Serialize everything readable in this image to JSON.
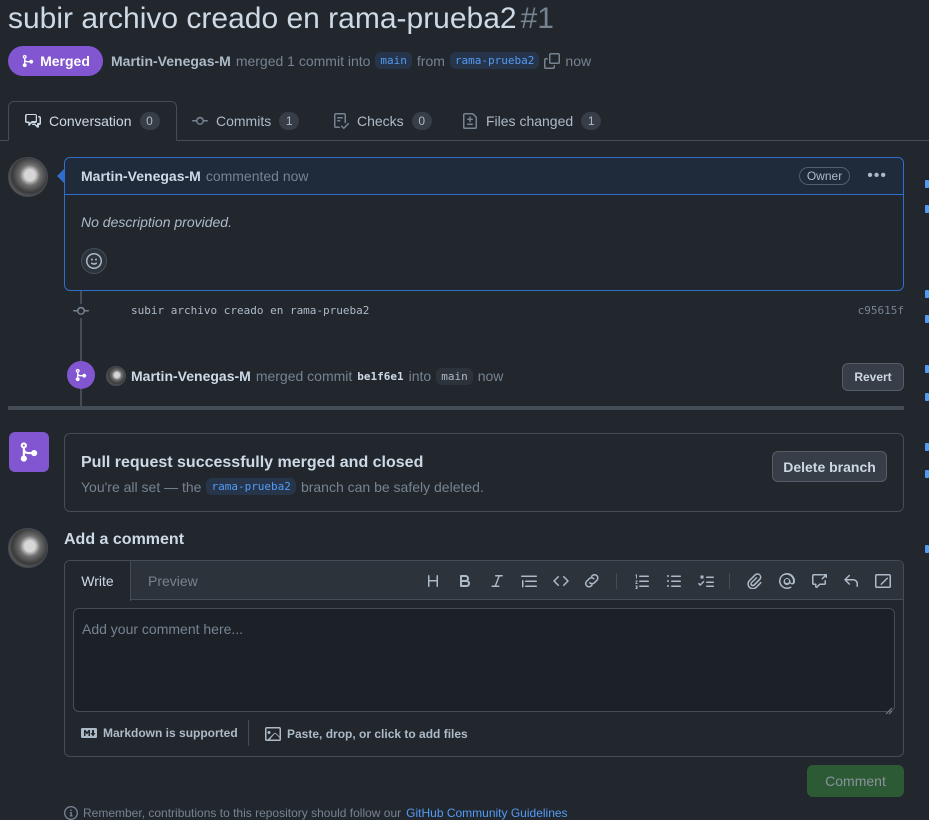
{
  "pr": {
    "title": "subir archivo creado en rama-prueba2",
    "number": "#1",
    "state_label": "Merged",
    "author": "Martin-Venegas-M",
    "merge_text": "merged 1 commit into",
    "base_branch": "main",
    "from_text": "from",
    "head_branch": "rama-prueba2",
    "time": "now"
  },
  "tabs": [
    {
      "label": "Conversation",
      "count": "0"
    },
    {
      "label": "Commits",
      "count": "1"
    },
    {
      "label": "Checks",
      "count": "0"
    },
    {
      "label": "Files changed",
      "count": "1"
    }
  ],
  "comment": {
    "author": "Martin-Venegas-M",
    "action": "commented now",
    "role": "Owner",
    "body": "No description provided."
  },
  "commit": {
    "message": "subir archivo creado en rama-prueba2",
    "sha": "c95615f"
  },
  "merge_event": {
    "author": "Martin-Venegas-M",
    "text": "merged commit",
    "sha": "be1f6e1",
    "into": "into",
    "branch": "main",
    "time": "now",
    "revert_label": "Revert"
  },
  "merge_status": {
    "title": "Pull request successfully merged and closed",
    "desc_before": "You're all set — the",
    "branch": "rama-prueba2",
    "desc_after": "branch can be safely deleted.",
    "delete_label": "Delete branch"
  },
  "new_comment": {
    "title": "Add a comment",
    "write_tab": "Write",
    "preview_tab": "Preview",
    "placeholder": "Add your comment here...",
    "markdown_hint": "Markdown is supported",
    "paste_hint": "Paste, drop, or click to add files",
    "submit_label": "Comment"
  },
  "footer": {
    "remember_text": "Remember, contributions to this repository should follow our",
    "guidelines_link": "GitHub Community Guidelines"
  },
  "colors": {
    "merged_purple": "#8256d0",
    "accent_blue": "#539bf5",
    "success_green": "#347d39"
  }
}
